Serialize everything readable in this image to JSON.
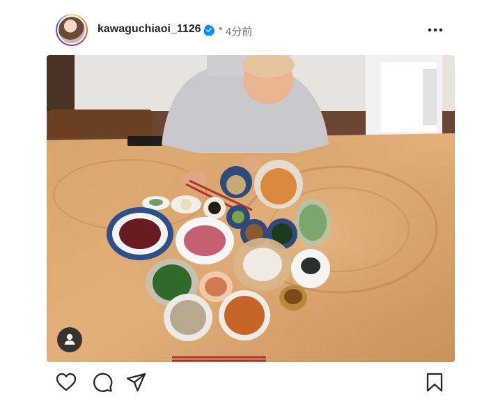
{
  "post": {
    "username": "kawaguchiaoi_1126",
    "time_ago": "4分前",
    "separator": "•"
  },
  "icons": {
    "verified": "verified-badge-icon",
    "more": "more-options-icon",
    "like": "heart-icon",
    "comment": "comment-icon",
    "share": "send-icon",
    "save": "bookmark-icon",
    "tag": "user-tag-icon"
  },
  "colors": {
    "verified_blue": "#0095f6",
    "text": "#262626",
    "muted": "#737373"
  }
}
